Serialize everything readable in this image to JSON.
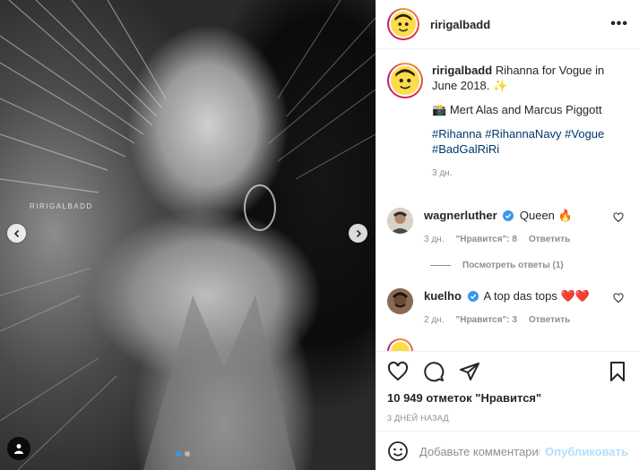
{
  "photo": {
    "watermark": "RIRIGALBADD",
    "carousel_total": 2,
    "carousel_active": 1
  },
  "header": {
    "username": "ririgalbadd",
    "more_label": "•••"
  },
  "caption": {
    "username": "ririgalbadd",
    "text": "Rihanna for Vogue in June 2018. ✨",
    "credit_emoji": "📸",
    "credit": "Mert Alas and Marcus Piggott",
    "hashtags_line1": "#Rihanna #RihannaNavy #Vogue",
    "hashtags_line2": "#BadGalRiRi",
    "time": "3 дн."
  },
  "comments": [
    {
      "username": "wagnerluther",
      "text": "Queen 🔥",
      "time": "3 дн.",
      "likes": "\"Нравится\": 8",
      "reply": "Ответить",
      "view_replies": "Посмотреть ответы (1)"
    },
    {
      "username": "kuelho",
      "text": "A top das tops ❤️❤️",
      "time": "2 дн.",
      "likes": "\"Нравится\": 3",
      "reply": "Ответить"
    }
  ],
  "actions": {
    "likes_count": "10 949 отметок \"Нравится\"",
    "date": "3 ДНЕЙ НАЗАД"
  },
  "add_comment": {
    "placeholder": "Добавьте комментарий...",
    "post_label": "Опубликовать"
  },
  "colors": {
    "link": "#00376b",
    "verified": "#3897f0",
    "post_disabled": "#b2dffc",
    "heart_red": "#ed4956"
  }
}
